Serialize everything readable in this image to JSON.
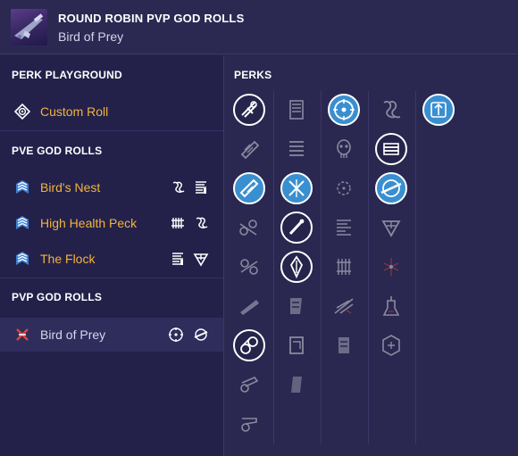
{
  "header": {
    "title": "ROUND ROBIN PVP GOD ROLLS",
    "subtitle": "Bird of Prey",
    "weapon_icon": "sniper-rifle-icon"
  },
  "sections": {
    "perk_playground": "PERK PLAYGROUND",
    "pve": "PVE GOD ROLLS",
    "pvp": "PVP GOD ROLLS"
  },
  "rolls": {
    "custom": {
      "label": "Custom Roll",
      "icon": "diamond-target-icon"
    },
    "birds_nest": {
      "label": "Bird's Nest",
      "icon": "chevron-rank-icon"
    },
    "high_health_peck": {
      "label": "High Health Peck",
      "icon": "chevron-rank-icon"
    },
    "the_flock": {
      "label": "The Flock",
      "icon": "chevron-rank-icon"
    },
    "bird_of_prey": {
      "label": "Bird of Prey",
      "icon": "crossed-red-icon"
    }
  },
  "perks_title": "PERKS",
  "colors": {
    "accent_gold": "#f2b33e",
    "selected_perk": "#3a8fd0",
    "background": "#28264a",
    "pvp_red": "#e0443c"
  }
}
